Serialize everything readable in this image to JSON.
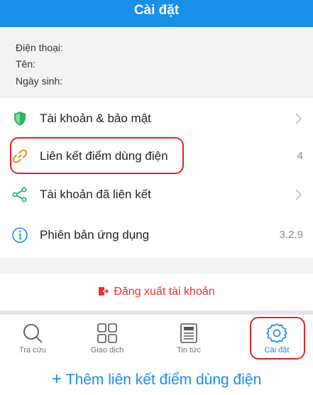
{
  "header": {
    "title": "Cài đặt"
  },
  "profile": {
    "phone_label": "Điện thoại:",
    "name_label": "Tên:",
    "birth_label": "Ngày sinh:"
  },
  "menu": [
    {
      "label": "Tài khoản & bảo mật",
      "icon": "shield-icon"
    },
    {
      "label": "Liên kết điểm dùng điện",
      "value": "4",
      "icon": "link-icon"
    },
    {
      "label": "Tài khoản đã liên kết",
      "icon": "share-icon"
    },
    {
      "label": "Phiên bản ứng dụng",
      "value": "3.2.9",
      "icon": "info-icon"
    }
  ],
  "logout": {
    "label": "Đăng xuất tài khoản"
  },
  "tabs": [
    {
      "label": "Tra cứu"
    },
    {
      "label": "Giao dịch"
    },
    {
      "label": "Tin tức"
    },
    {
      "label": "Cài đặt",
      "active": true
    }
  ],
  "add_link": {
    "label": "Thêm liên kết điểm dùng điện"
  },
  "colors": {
    "primary": "#1a8fe8",
    "danger": "#e5322d",
    "success": "#2db55d",
    "highlight": "#e02424"
  }
}
